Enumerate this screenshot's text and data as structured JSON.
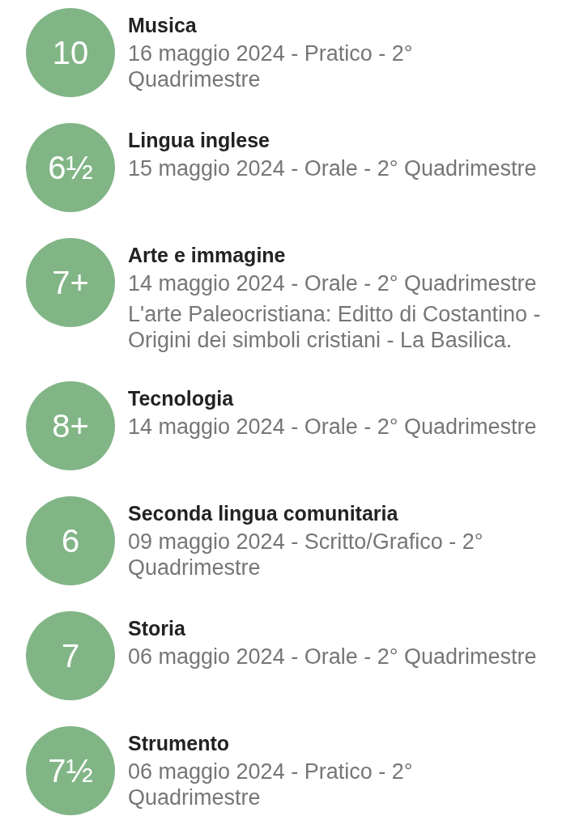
{
  "grades": [
    {
      "grade": "10",
      "subject": "Musica",
      "details": "16 maggio 2024 - Pratico - 2° Quadrimestre"
    },
    {
      "grade": "6½",
      "subject": "Lingua inglese",
      "details": "15 maggio 2024 - Orale - 2° Quadrimestre"
    },
    {
      "grade": "7+",
      "subject": "Arte e immagine",
      "details": "14 maggio 2024 - Orale - 2° Quadrimestre",
      "note": "L'arte Paleocristiana: Editto di Costantino - Origini dei simboli cristiani - La Basilica."
    },
    {
      "grade": "8+",
      "subject": "Tecnologia",
      "details": "14 maggio 2024 - Orale - 2° Quadrimestre"
    },
    {
      "grade": "6",
      "subject": "Seconda lingua comunitaria",
      "details": "09 maggio 2024 - Scritto/Grafico - 2° Quadrimestre"
    },
    {
      "grade": "7",
      "subject": "Storia",
      "details": "06 maggio 2024 - Orale - 2° Quadrimestre"
    },
    {
      "grade": "7½",
      "subject": "Strumento",
      "details": "06 maggio 2024 - Pratico - 2° Quadrimestre"
    }
  ]
}
